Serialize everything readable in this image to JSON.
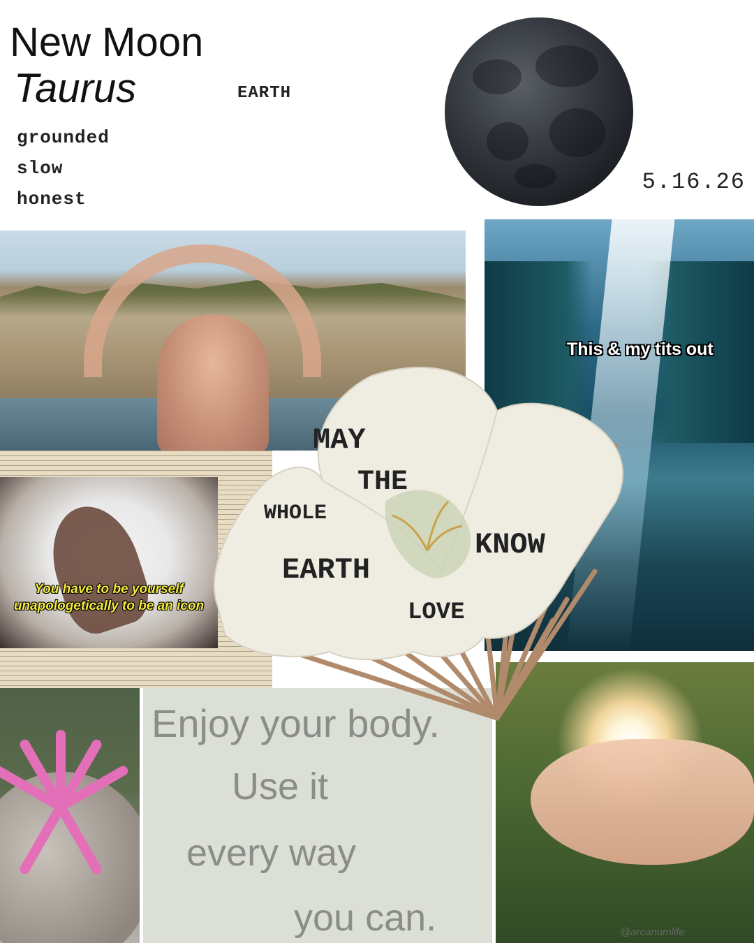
{
  "header": {
    "title": "New Moon",
    "subtitle": "Taurus",
    "element": "EARTH",
    "keywords": [
      "grounded",
      "slow",
      "honest"
    ],
    "date": "5.16.26"
  },
  "images": {
    "waterfall_caption": "This & my tits out",
    "book_caption_line1": "You have to be yourself",
    "book_caption_line2": "unapologetically to be an icon",
    "quote_lines": [
      "Enjoy your body.",
      "Use it",
      "every way",
      "you can."
    ]
  },
  "fan": {
    "words": [
      "MAY",
      "THE",
      "WHOLE",
      "KNOW",
      "EARTH",
      "LOVE"
    ]
  },
  "watermark": "@arcanumlife",
  "colors": {
    "moon": "#2a2d33",
    "fan_paper": "#f1efe6",
    "fan_ribs": "#b08a6a",
    "meme_yellow": "#f3ea3a",
    "quote_text": "#8a8d88"
  }
}
